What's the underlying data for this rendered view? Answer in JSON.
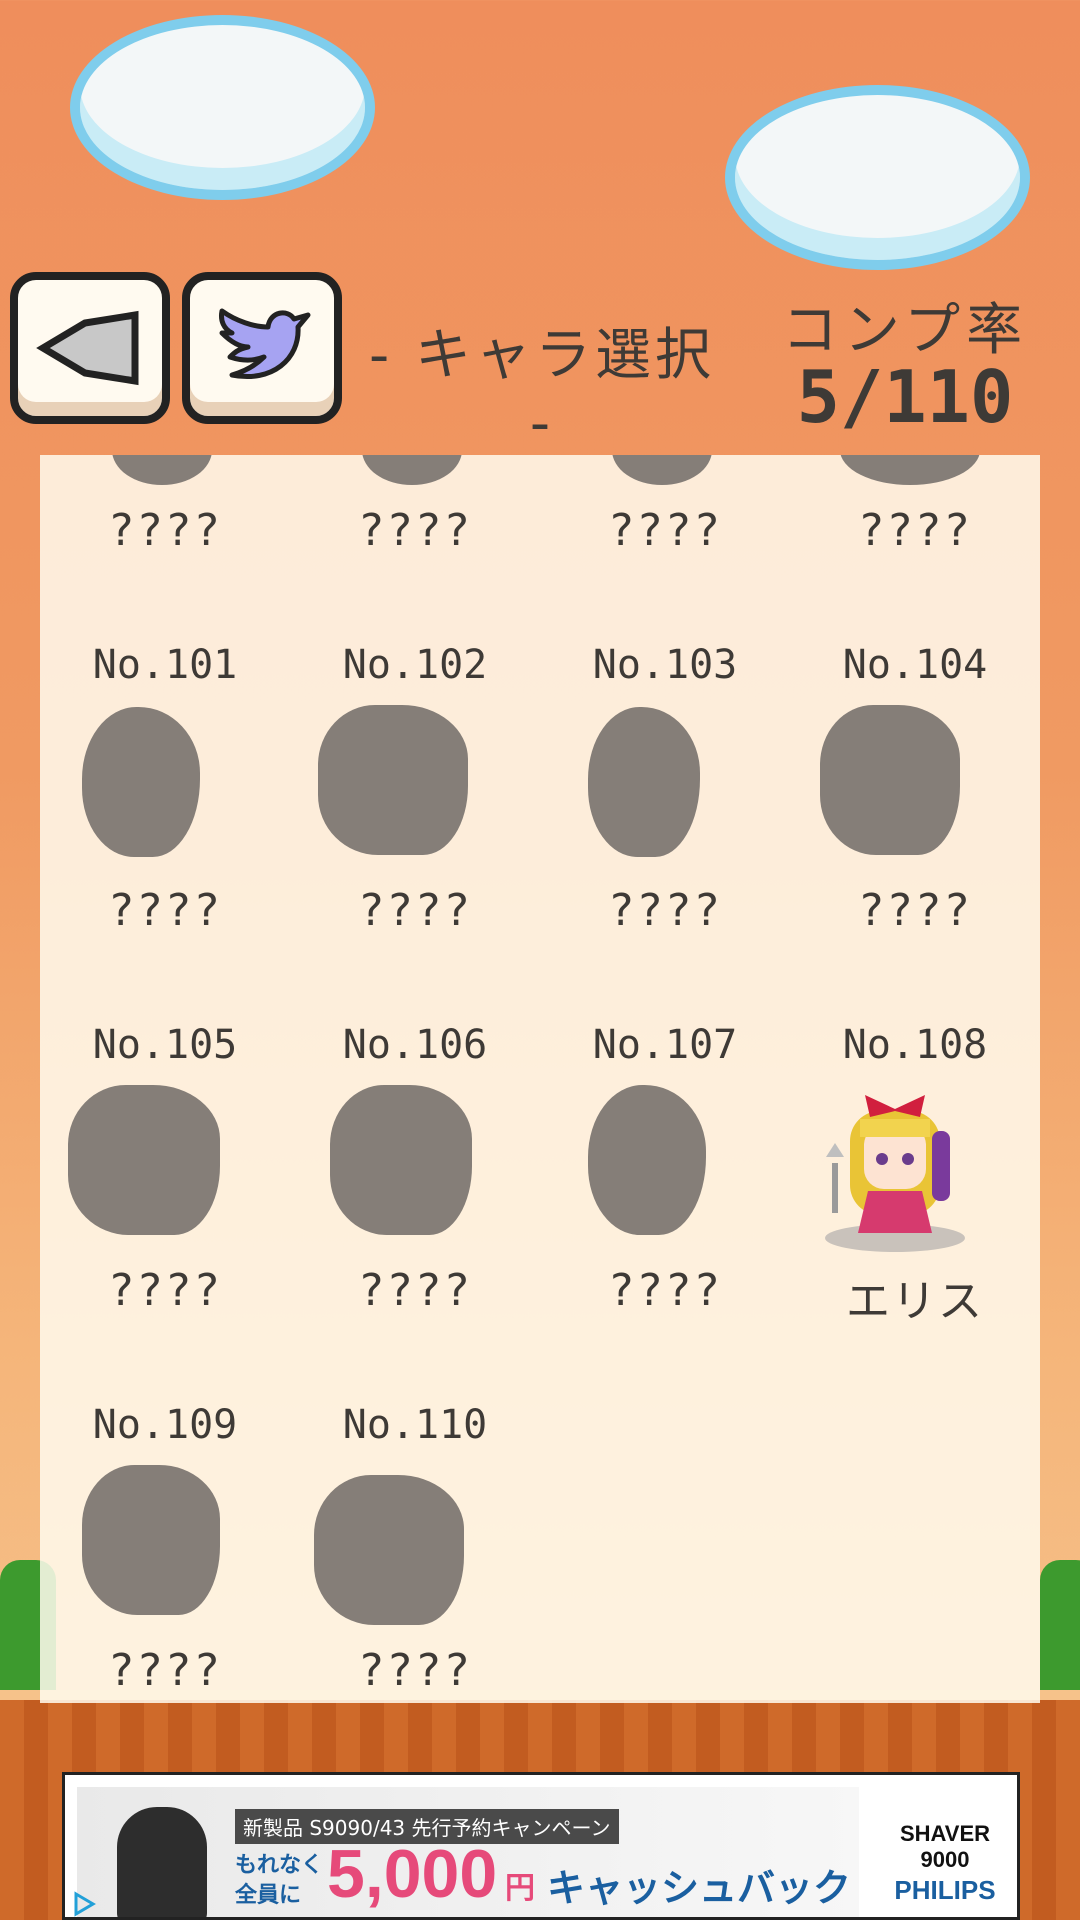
{
  "header": {
    "title": "- キャラ選択 -",
    "completion_label": "コンプ率",
    "completion_value": "5/110",
    "back_icon": "speaker-back-icon",
    "share_icon": "bird-icon"
  },
  "grid": {
    "partial_row_names": [
      "????",
      "????",
      "????",
      "????"
    ],
    "cells": [
      {
        "number": "No.101",
        "name": "????",
        "unlocked": false
      },
      {
        "number": "No.102",
        "name": "????",
        "unlocked": false
      },
      {
        "number": "No.103",
        "name": "????",
        "unlocked": false
      },
      {
        "number": "No.104",
        "name": "????",
        "unlocked": false
      },
      {
        "number": "No.105",
        "name": "????",
        "unlocked": false
      },
      {
        "number": "No.106",
        "name": "????",
        "unlocked": false
      },
      {
        "number": "No.107",
        "name": "????",
        "unlocked": false
      },
      {
        "number": "No.108",
        "name": "エリス",
        "unlocked": true
      },
      {
        "number": "No.109",
        "name": "????",
        "unlocked": false
      },
      {
        "number": "No.110",
        "name": "????",
        "unlocked": false
      }
    ]
  },
  "ad": {
    "tag": "新製品 S9090/43 先行予約キャンペーン",
    "line_a": "もれなく",
    "line_b": "全員に",
    "amount": "5,000",
    "yen": "円",
    "cashback": "キャッシュバック",
    "series": "SHAVER 9000",
    "brand": "PHILIPS"
  },
  "colors": {
    "sky": "#ef8e5c",
    "text": "#3e3a36",
    "silhouette": "#857e78",
    "cloud_border": "#7fcdec"
  }
}
